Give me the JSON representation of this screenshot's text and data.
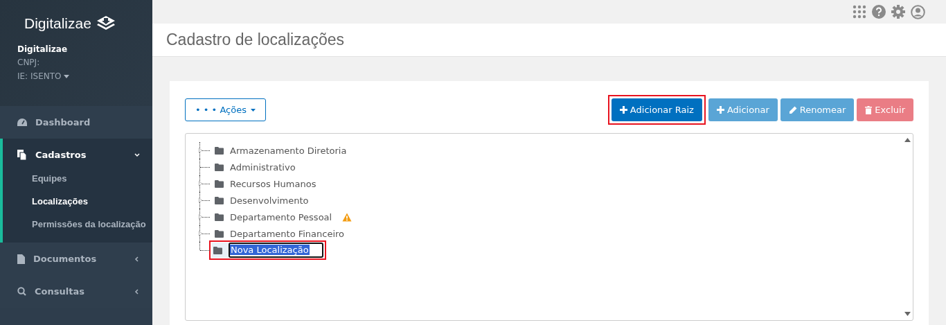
{
  "sidebar": {
    "logo": "Digitalizae",
    "company": {
      "name": "Digitalizae",
      "cnpj_label": "CNPJ:",
      "ie": "IE: ISENTO"
    },
    "menu": [
      {
        "label": "Dashboard",
        "kind": "link",
        "expanded": false
      },
      {
        "label": "Cadastros",
        "kind": "group",
        "expanded": true,
        "children": [
          {
            "label": "Equipes",
            "selected": false
          },
          {
            "label": "Localizações",
            "selected": true
          },
          {
            "label": "Permissões da localização",
            "selected": false
          }
        ]
      },
      {
        "label": "Documentos",
        "kind": "group",
        "expanded": false
      },
      {
        "label": "Consultas",
        "kind": "group",
        "expanded": false
      }
    ]
  },
  "page": {
    "title": "Cadastro de localizações"
  },
  "actions_button": {
    "label": "• • • Ações"
  },
  "buttons": [
    {
      "label": "Adicionar Raiz",
      "kind": "primary",
      "disabled": false,
      "highlighted": true
    },
    {
      "label": "Adicionar",
      "kind": "primary",
      "disabled": true,
      "highlighted": false
    },
    {
      "label": "Renomear",
      "kind": "primary",
      "disabled": true,
      "highlighted": false
    },
    {
      "label": "Excluir",
      "kind": "danger",
      "disabled": true,
      "highlighted": false
    }
  ],
  "tree": [
    {
      "label": "Armazenamento Diretoria",
      "expandable": true,
      "warning": false,
      "editing": false,
      "highlighted": false
    },
    {
      "label": "Administrativo",
      "expandable": false,
      "warning": false,
      "editing": false,
      "highlighted": false
    },
    {
      "label": "Recursos Humanos",
      "expandable": true,
      "warning": false,
      "editing": false,
      "highlighted": false
    },
    {
      "label": "Desenvolvimento",
      "expandable": true,
      "warning": false,
      "editing": false,
      "highlighted": false
    },
    {
      "label": "Departamento Pessoal",
      "expandable": true,
      "warning": true,
      "editing": false,
      "highlighted": false
    },
    {
      "label": "Departamento Financeiro",
      "expandable": true,
      "warning": false,
      "editing": false,
      "highlighted": false
    },
    {
      "label": "Nova Localização",
      "expandable": false,
      "warning": false,
      "editing": true,
      "highlighted": true
    }
  ]
}
